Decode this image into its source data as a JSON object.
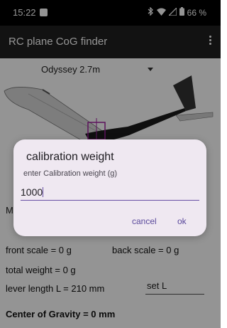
{
  "status_bar": {
    "time": "15:22",
    "icons": [
      "image-notification-icon",
      "bluetooth-icon",
      "wifi-icon",
      "signal-icon",
      "battery-icon"
    ],
    "battery": "66 %"
  },
  "app_bar": {
    "title": "RC plane CoG finder",
    "overflow_icon": "more-vert-icon"
  },
  "main": {
    "plane_selector": "Odyssey 2.7m",
    "m_label": "M",
    "front_scale": "front scale = 0 g",
    "back_scale": "back scale = 0 g",
    "total_weight": "total weight = 0 g",
    "lever_length": "lever length L = 210 mm",
    "set_l_label": "set L",
    "center_of_gravity": "Center of Gravity = 0 mm"
  },
  "dialog": {
    "title": "calibration weight",
    "message": "enter Calibration weight (g)",
    "input_value": "1000",
    "cancel_label": "cancel",
    "ok_label": "ok"
  },
  "colors": {
    "accent": "#6750a4",
    "dialog_bg": "#efe8f1",
    "app_bar": "#1f1f1f",
    "cog_marker": "#a020a0"
  }
}
